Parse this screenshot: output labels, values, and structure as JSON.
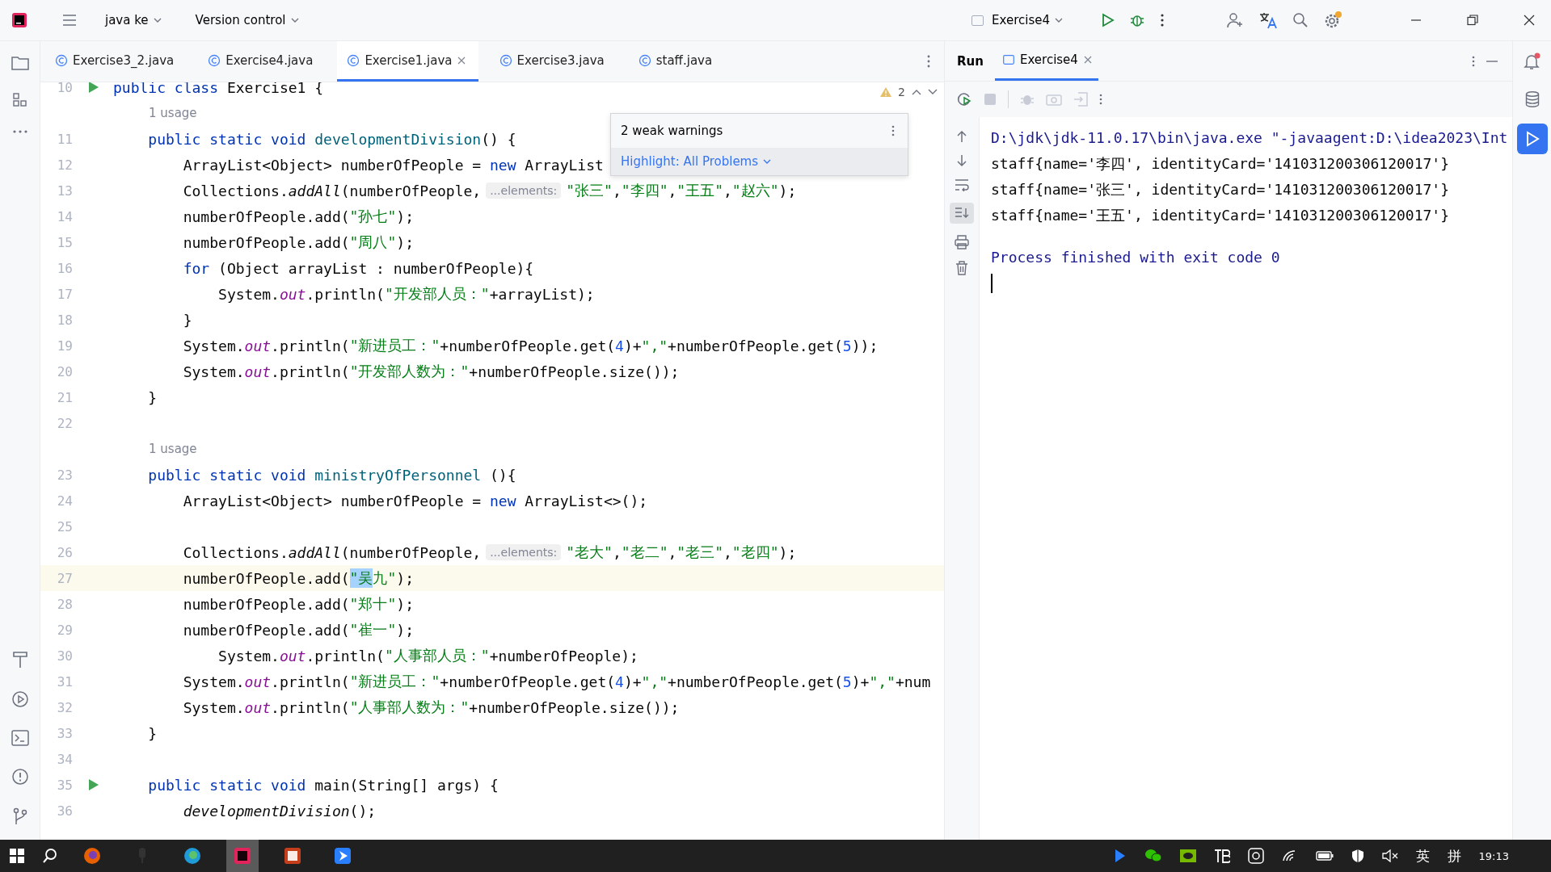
{
  "titlebar": {
    "project": "java ke",
    "vcs": "Version control",
    "run_config": "Exercise4"
  },
  "editor_tabs": [
    {
      "label": "Exercise3_2.java",
      "selected": false
    },
    {
      "label": "Exercise4.java",
      "selected": false
    },
    {
      "label": "Exercise1.java",
      "selected": true
    },
    {
      "label": "Exercise3.java",
      "selected": false
    },
    {
      "label": "staff.java",
      "selected": false
    }
  ],
  "warnings_count": "2",
  "popup": {
    "title": "2 weak warnings",
    "action": "Highlight: All Problems"
  },
  "lines": [
    {
      "kind": "code",
      "number": "10",
      "run_marker": true,
      "current": false,
      "tokens": [
        {
          "kind": "keyword",
          "text": "public class"
        },
        {
          "kind": "plain",
          "text": " Exercise1 {"
        }
      ]
    },
    {
      "kind": "usage",
      "text": "1 usage"
    },
    {
      "kind": "code",
      "number": "11",
      "run_marker": false,
      "current": false,
      "tokens": [
        {
          "kind": "keyword",
          "text": "    public static void "
        },
        {
          "kind": "method",
          "text": "developmentDivision"
        },
        {
          "kind": "plain",
          "text": "() {"
        }
      ]
    },
    {
      "kind": "code",
      "number": "12",
      "run_marker": false,
      "current": false,
      "tokens": [
        {
          "kind": "plain",
          "text": "        ArrayList<Object> numberOfPeople = "
        },
        {
          "kind": "keyword",
          "text": "new"
        },
        {
          "kind": "plain",
          "text": " ArrayList"
        }
      ]
    },
    {
      "kind": "code",
      "number": "13",
      "run_marker": false,
      "current": false,
      "tokens": [
        {
          "kind": "plain",
          "text": "        Collections."
        },
        {
          "kind": "static_call",
          "text": "addAll"
        },
        {
          "kind": "plain",
          "text": "(numberOfPeople,"
        },
        {
          "kind": "hint",
          "text": "...elements:"
        },
        {
          "kind": "string",
          "text": "\"张三\""
        },
        {
          "kind": "plain",
          "text": ","
        },
        {
          "kind": "string",
          "text": "\"李四\""
        },
        {
          "kind": "plain",
          "text": ","
        },
        {
          "kind": "string",
          "text": "\"王五\""
        },
        {
          "kind": "plain",
          "text": ","
        },
        {
          "kind": "string",
          "text": "\"赵六\""
        },
        {
          "kind": "plain",
          "text": ");"
        }
      ]
    },
    {
      "kind": "code",
      "number": "14",
      "run_marker": false,
      "current": false,
      "tokens": [
        {
          "kind": "plain",
          "text": "        numberOfPeople.add("
        },
        {
          "kind": "string",
          "text": "\"孙七\""
        },
        {
          "kind": "plain",
          "text": ");"
        }
      ]
    },
    {
      "kind": "code",
      "number": "15",
      "run_marker": false,
      "current": false,
      "tokens": [
        {
          "kind": "plain",
          "text": "        numberOfPeople.add("
        },
        {
          "kind": "string",
          "text": "\"周八\""
        },
        {
          "kind": "plain",
          "text": ");"
        }
      ]
    },
    {
      "kind": "code",
      "number": "16",
      "run_marker": false,
      "current": false,
      "tokens": [
        {
          "kind": "keyword",
          "text": "        for"
        },
        {
          "kind": "plain",
          "text": " (Object arrayList : numberOfPeople){"
        }
      ]
    },
    {
      "kind": "code",
      "number": "17",
      "run_marker": false,
      "current": false,
      "tokens": [
        {
          "kind": "plain",
          "text": "            System."
        },
        {
          "kind": "field",
          "text": "out"
        },
        {
          "kind": "plain",
          "text": ".println("
        },
        {
          "kind": "string",
          "text": "\"开发部人员：\""
        },
        {
          "kind": "plain",
          "text": "+arrayList);"
        }
      ]
    },
    {
      "kind": "code",
      "number": "18",
      "run_marker": false,
      "current": false,
      "tokens": [
        {
          "kind": "plain",
          "text": "        }"
        }
      ]
    },
    {
      "kind": "code",
      "number": "19",
      "run_marker": false,
      "current": false,
      "tokens": [
        {
          "kind": "plain",
          "text": "        System."
        },
        {
          "kind": "field",
          "text": "out"
        },
        {
          "kind": "plain",
          "text": ".println("
        },
        {
          "kind": "string",
          "text": "\"新进员工：\""
        },
        {
          "kind": "plain",
          "text": "+numberOfPeople.get("
        },
        {
          "kind": "number",
          "text": "4"
        },
        {
          "kind": "plain",
          "text": ")+"
        },
        {
          "kind": "string",
          "text": "\",\""
        },
        {
          "kind": "plain",
          "text": "+numberOfPeople.get("
        },
        {
          "kind": "number",
          "text": "5"
        },
        {
          "kind": "plain",
          "text": "));"
        }
      ]
    },
    {
      "kind": "code",
      "number": "20",
      "run_marker": false,
      "current": false,
      "tokens": [
        {
          "kind": "plain",
          "text": "        System."
        },
        {
          "kind": "field",
          "text": "out"
        },
        {
          "kind": "plain",
          "text": ".println("
        },
        {
          "kind": "string",
          "text": "\"开发部人数为：\""
        },
        {
          "kind": "plain",
          "text": "+numberOfPeople.size());"
        }
      ]
    },
    {
      "kind": "code",
      "number": "21",
      "run_marker": false,
      "current": false,
      "tokens": [
        {
          "kind": "plain",
          "text": "    }"
        }
      ]
    },
    {
      "kind": "code",
      "number": "22",
      "run_marker": false,
      "current": false
    },
    {
      "kind": "usage",
      "text": "1 usage"
    },
    {
      "kind": "code",
      "number": "23",
      "run_marker": false,
      "current": false,
      "tokens": [
        {
          "kind": "keyword",
          "text": "    public static void "
        },
        {
          "kind": "method",
          "text": "ministryOfPersonnel"
        },
        {
          "kind": "plain",
          "text": " (){"
        }
      ]
    },
    {
      "kind": "code",
      "number": "24",
      "run_marker": false,
      "current": false,
      "tokens": [
        {
          "kind": "plain",
          "text": "        ArrayList<Object> numberOfPeople = "
        },
        {
          "kind": "keyword",
          "text": "new"
        },
        {
          "kind": "plain",
          "text": " ArrayList<>();"
        }
      ]
    },
    {
      "kind": "code",
      "number": "25",
      "run_marker": false,
      "current": false
    },
    {
      "kind": "code",
      "number": "26",
      "run_marker": false,
      "current": false,
      "tokens": [
        {
          "kind": "plain",
          "text": "        Collections."
        },
        {
          "kind": "static_call",
          "text": "addAll"
        },
        {
          "kind": "plain",
          "text": "(numberOfPeople,"
        },
        {
          "kind": "hint",
          "text": "...elements:"
        },
        {
          "kind": "string",
          "text": "\"老大\""
        },
        {
          "kind": "plain",
          "text": ","
        },
        {
          "kind": "string",
          "text": "\"老二\""
        },
        {
          "kind": "plain",
          "text": ","
        },
        {
          "kind": "string",
          "text": "\"老三\""
        },
        {
          "kind": "plain",
          "text": ","
        },
        {
          "kind": "string",
          "text": "\"老四\""
        },
        {
          "kind": "plain",
          "text": ");"
        }
      ]
    },
    {
      "kind": "code",
      "number": "27",
      "run_marker": false,
      "current": true,
      "tokens": [
        {
          "kind": "plain",
          "text": "        numberOfPeople.add("
        },
        {
          "kind": "selected_string",
          "text": "\"吴"
        },
        {
          "kind": "string",
          "text": "九\""
        },
        {
          "kind": "plain",
          "text": ");"
        }
      ]
    },
    {
      "kind": "code",
      "number": "28",
      "run_marker": false,
      "current": false,
      "tokens": [
        {
          "kind": "plain",
          "text": "        numberOfPeople.add("
        },
        {
          "kind": "string",
          "text": "\"郑十\""
        },
        {
          "kind": "plain",
          "text": ");"
        }
      ]
    },
    {
      "kind": "code",
      "number": "29",
      "run_marker": false,
      "current": false,
      "tokens": [
        {
          "kind": "plain",
          "text": "        numberOfPeople.add("
        },
        {
          "kind": "string",
          "text": "\"崔一\""
        },
        {
          "kind": "plain",
          "text": ");"
        }
      ]
    },
    {
      "kind": "code",
      "number": "30",
      "run_marker": false,
      "current": false,
      "tokens": [
        {
          "kind": "plain",
          "text": "            System."
        },
        {
          "kind": "field",
          "text": "out"
        },
        {
          "kind": "plain",
          "text": ".println("
        },
        {
          "kind": "string",
          "text": "\"人事部人员：\""
        },
        {
          "kind": "plain",
          "text": "+numberOfPeople);"
        }
      ]
    },
    {
      "kind": "code",
      "number": "31",
      "run_marker": false,
      "current": false,
      "tokens": [
        {
          "kind": "plain",
          "text": "        System."
        },
        {
          "kind": "field",
          "text": "out"
        },
        {
          "kind": "plain",
          "text": ".println("
        },
        {
          "kind": "string",
          "text": "\"新进员工：\""
        },
        {
          "kind": "plain",
          "text": "+numberOfPeople.get("
        },
        {
          "kind": "number",
          "text": "4"
        },
        {
          "kind": "plain",
          "text": ")+"
        },
        {
          "kind": "string",
          "text": "\",\""
        },
        {
          "kind": "plain",
          "text": "+numberOfPeople.get("
        },
        {
          "kind": "number",
          "text": "5"
        },
        {
          "kind": "plain",
          "text": ")+"
        },
        {
          "kind": "string",
          "text": "\",\""
        },
        {
          "kind": "plain",
          "text": "+num"
        }
      ]
    },
    {
      "kind": "code",
      "number": "32",
      "run_marker": false,
      "current": false,
      "tokens": [
        {
          "kind": "plain",
          "text": "        System."
        },
        {
          "kind": "field",
          "text": "out"
        },
        {
          "kind": "plain",
          "text": ".println("
        },
        {
          "kind": "string",
          "text": "\"人事部人数为：\""
        },
        {
          "kind": "plain",
          "text": "+numberOfPeople.size());"
        }
      ]
    },
    {
      "kind": "code",
      "number": "33",
      "run_marker": false,
      "current": false,
      "tokens": [
        {
          "kind": "plain",
          "text": "    }"
        }
      ]
    },
    {
      "kind": "code",
      "number": "34",
      "run_marker": false,
      "current": false
    },
    {
      "kind": "code",
      "number": "35",
      "run_marker": true,
      "current": false,
      "tokens": [
        {
          "kind": "keyword",
          "text": "    public static void"
        },
        {
          "kind": "plain",
          "text": " main(String[] args) {"
        }
      ]
    },
    {
      "kind": "code",
      "number": "36",
      "run_marker": false,
      "current": false,
      "tokens": [
        {
          "kind": "static_call",
          "text": "        developmentDivision"
        },
        {
          "kind": "plain",
          "text": "();"
        }
      ]
    }
  ],
  "run": {
    "title": "Run",
    "tabs": [
      {
        "label": "Exercise4",
        "selected": true
      }
    ],
    "console": [
      {
        "kind": "command",
        "text": "D:\\jdk\\jdk-11.0.17\\bin\\java.exe \"-javaagent:D:\\idea2023\\Int"
      },
      {
        "kind": "output",
        "text": "staff{name='李四', identityCard='141031200306120017'}"
      },
      {
        "kind": "output",
        "text": "staff{name='张三', identityCard='141031200306120017'}"
      },
      {
        "kind": "output",
        "text": "staff{name='王五', identityCard='141031200306120017'}"
      },
      {
        "kind": "status",
        "text": "Process finished with exit code 0"
      }
    ]
  },
  "taskbar": {
    "apps": [
      {
        "kind": "firefox",
        "selected": false
      },
      {
        "kind": "mic",
        "selected": false
      },
      {
        "kind": "edge",
        "selected": false
      },
      {
        "kind": "ide",
        "selected": true
      },
      {
        "kind": "slides",
        "selected": false
      },
      {
        "kind": "arrow",
        "selected": false
      }
    ],
    "tray_texts": [
      "英",
      "拼"
    ],
    "clock": "19:13"
  }
}
